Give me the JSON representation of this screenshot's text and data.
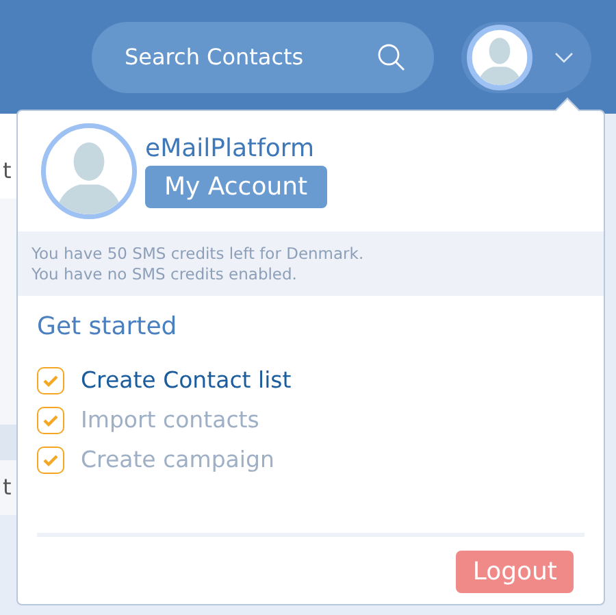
{
  "header": {
    "search": {
      "placeholder": "Search Contacts"
    }
  },
  "background": {
    "fragments": [
      "t",
      "t"
    ]
  },
  "account_menu": {
    "name": "eMailPlatform",
    "account_button": "My Account",
    "credits": [
      "You have 50 SMS credits left for Denmark.",
      "You have no SMS credits enabled."
    ],
    "get_started": {
      "title": "Get started",
      "steps": [
        {
          "label": "Create Contact list",
          "checked": true,
          "current": true
        },
        {
          "label": "Import contacts",
          "checked": true,
          "current": false
        },
        {
          "label": "Create campaign",
          "checked": true,
          "current": false
        }
      ]
    },
    "logout": "Logout"
  }
}
